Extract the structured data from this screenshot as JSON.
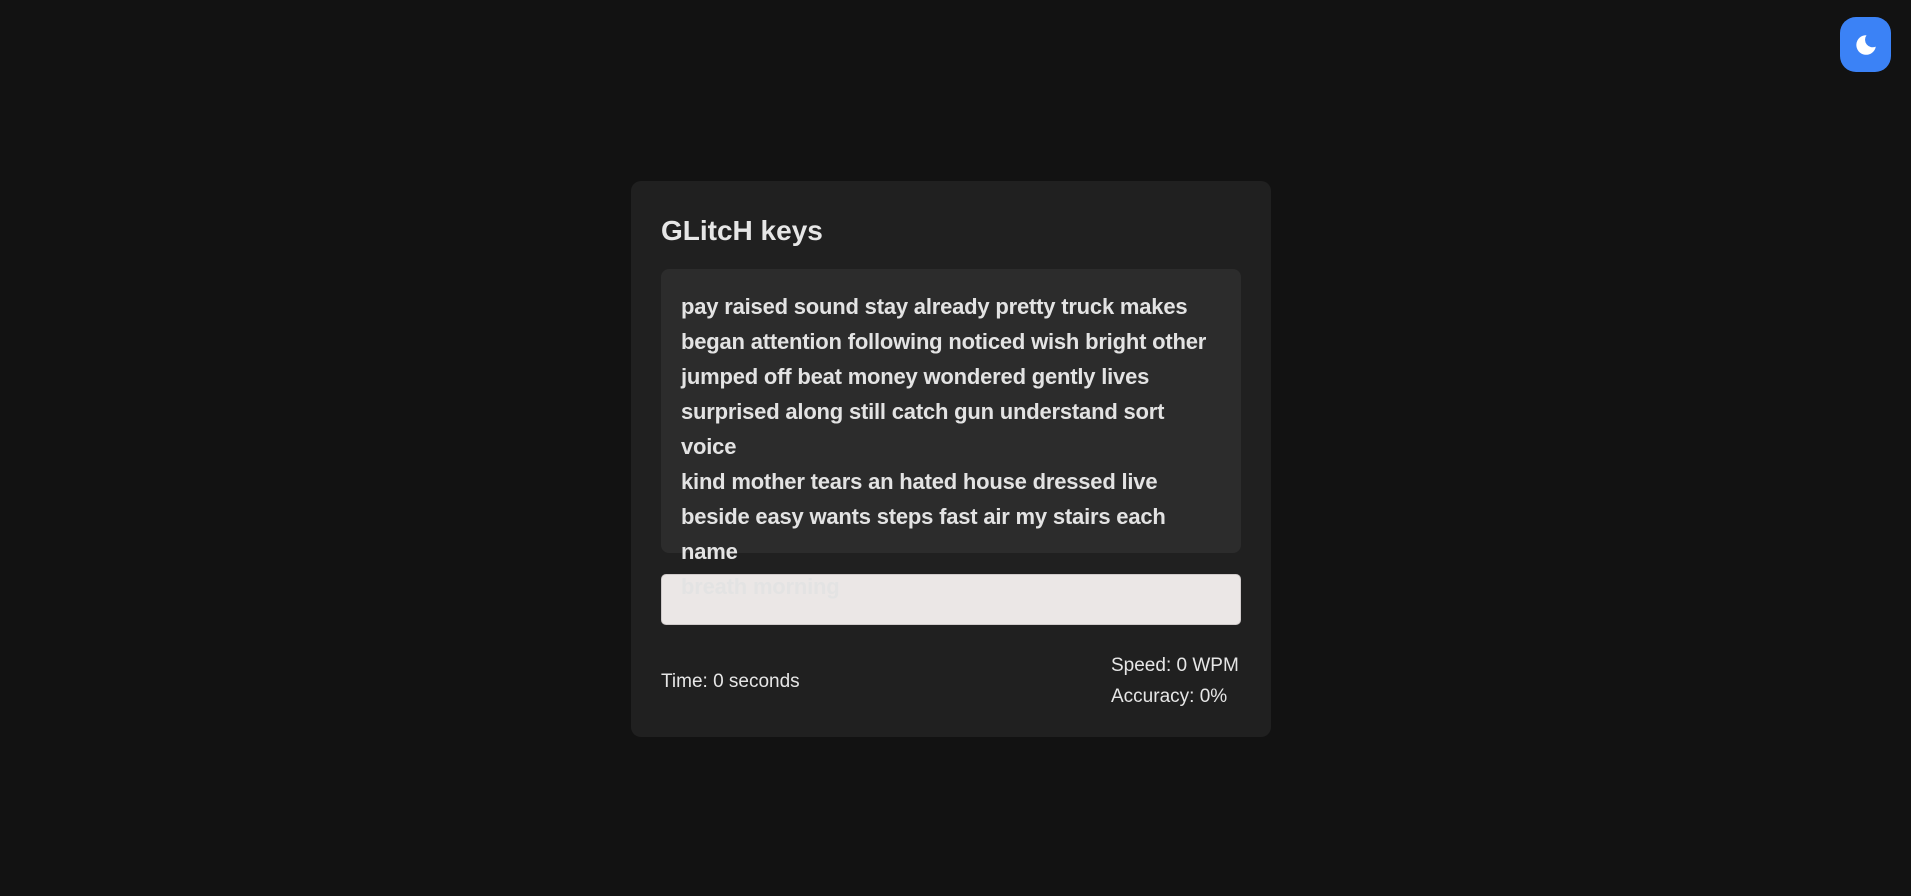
{
  "theme_toggle": {
    "icon": "moon-icon",
    "color": "#3b82f6"
  },
  "app": {
    "title": "GLitcH keys"
  },
  "passage": {
    "lines": [
      "pay raised sound stay already pretty truck makes",
      "began attention following noticed wish bright other",
      "jumped off beat money wondered gently lives",
      "surprised along still catch gun understand sort voice",
      "kind mother tears an hated house dressed live",
      "beside easy wants steps fast air my stairs each name",
      "breath morning"
    ]
  },
  "input": {
    "value": "",
    "placeholder": ""
  },
  "stats": {
    "time": "Time: 0 seconds",
    "speed": "Speed: 0 WPM",
    "accuracy": "Accuracy: 0%"
  }
}
